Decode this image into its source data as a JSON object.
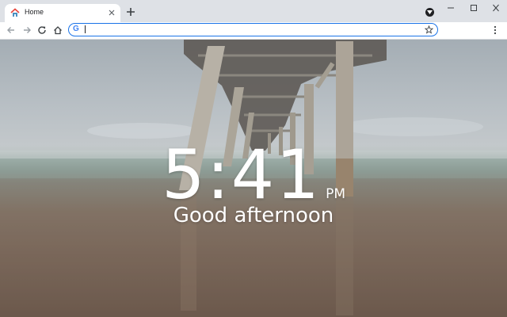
{
  "browser": {
    "tab": {
      "title": "Home",
      "favicon": "home-icon"
    },
    "toolbar": {
      "back_icon": "arrow-left-icon",
      "forward_icon": "arrow-right-icon",
      "reload_icon": "reload-icon",
      "home_icon": "home-icon",
      "search_engine_icon": "google-g-icon",
      "search_engine_letter": "G",
      "omnibox_value": "",
      "bookmark_icon": "star-icon",
      "menu_icon": "kebab-menu-icon"
    },
    "window_controls": [
      "minimize-icon",
      "maximize-icon",
      "close-icon"
    ]
  },
  "newtab": {
    "time": "5:41",
    "ampm": "PM",
    "greeting": "Good afternoon",
    "background": "pier-over-misty-sea-photo"
  },
  "colors": {
    "omnibox_focus": "#1a73e8",
    "tabstrip_bg": "#dee1e6",
    "text_white": "#ffffff"
  }
}
